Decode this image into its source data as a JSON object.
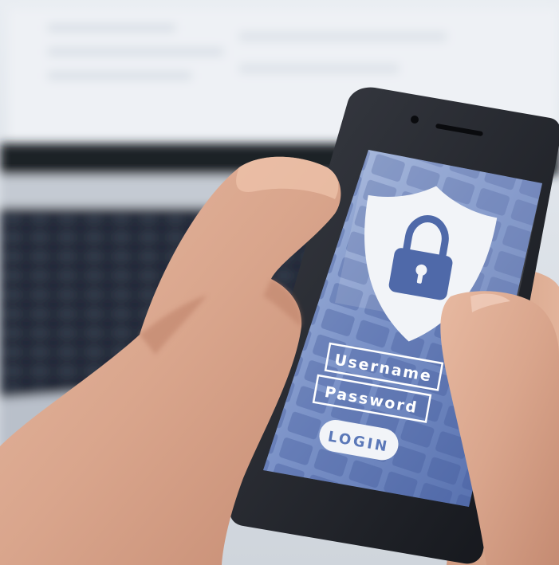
{
  "phone_screen": {
    "username_label": "Username",
    "password_label": "Password",
    "login_button": "LOGIN"
  },
  "icons": {
    "shield": "shield-icon",
    "lock": "padlock-icon"
  },
  "colors": {
    "screen_blue": "#5b78b8",
    "shield_white": "#f2f4f8",
    "skin": "#d9a58c"
  }
}
